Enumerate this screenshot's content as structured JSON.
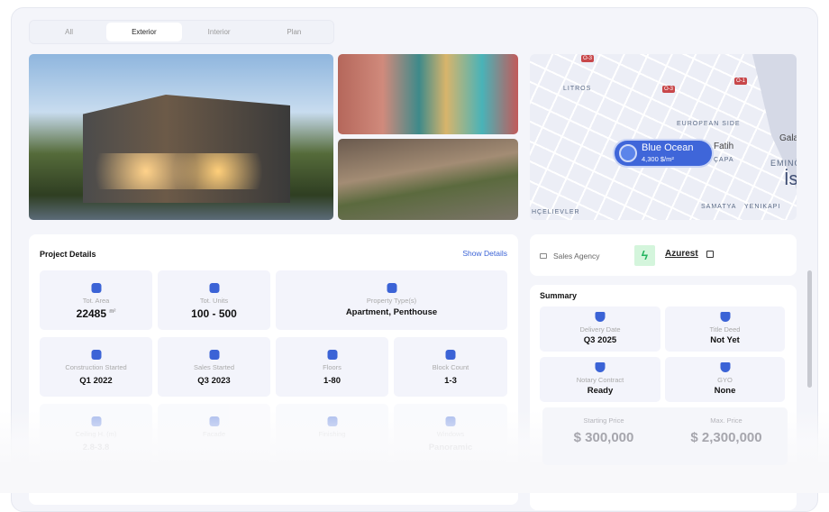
{
  "tabs": [
    {
      "label": "All"
    },
    {
      "label": "Exterior"
    },
    {
      "label": "Interior"
    },
    {
      "label": "Plan"
    }
  ],
  "map": {
    "labels": [
      "LITROS",
      "EUROPEAN SIDE",
      "Fatih",
      "ÇAPA",
      "Gala",
      "EMINÖ",
      "İs",
      "HÇELIEVLER",
      "SAMATYA",
      "YENIKAPI"
    ],
    "shields": [
      "O-3",
      "O-3",
      "O-1"
    ],
    "pin": {
      "name": "Blue Ocean",
      "price": "4,300 $/m²"
    }
  },
  "details": {
    "title": "Project Details",
    "show_details": "Show Details",
    "cells": [
      {
        "label": "Tot. Area",
        "value": "22485",
        "unit": "m²",
        "icon": "layers-copy-icon"
      },
      {
        "label": "Tot. Units",
        "value": "100 - 500",
        "icon": "grid-plus-icon"
      },
      {
        "label": "Property Type(s)",
        "value": "Apartment, Penthouse",
        "icon": "home-icon"
      },
      {
        "label": "Construction Started",
        "value": "Q1 2022",
        "icon": "shield-check-icon"
      },
      {
        "label": "Sales Started",
        "value": "Q3 2023",
        "icon": "tag-icon"
      },
      {
        "label": "Floors",
        "value": "1-80",
        "icon": "stack-icon"
      },
      {
        "label": "Block Count",
        "value": "1-3",
        "icon": "cube-icon"
      },
      {
        "label": "Ceiling H. (m)",
        "value": "2.8-3.8",
        "icon": "height-icon"
      },
      {
        "label": "Facade",
        "value": "",
        "icon": "brush-icon"
      },
      {
        "label": "Finishing",
        "value": "",
        "icon": "brush-icon"
      },
      {
        "label": "Windows",
        "value": "Panoramic",
        "icon": "windows-icon"
      }
    ]
  },
  "agency": {
    "label": "Sales Agency",
    "name": "Azurest"
  },
  "summary": {
    "title": "Summary",
    "cells": [
      {
        "label": "Delivery Date",
        "value": "Q3 2025"
      },
      {
        "label": "Title Deed",
        "value": "Not Yet"
      },
      {
        "label": "Notary Contract",
        "value": "Ready"
      },
      {
        "label": "GYO",
        "value": "None"
      }
    ],
    "starting_price_label": "Starting Price",
    "starting_price": "$ 300,000",
    "max_price_label": "Max. Price",
    "max_price": "$ 2,300,000"
  },
  "colors": {
    "accent": "#3b63d6",
    "agency_logo": "#22b35e"
  }
}
